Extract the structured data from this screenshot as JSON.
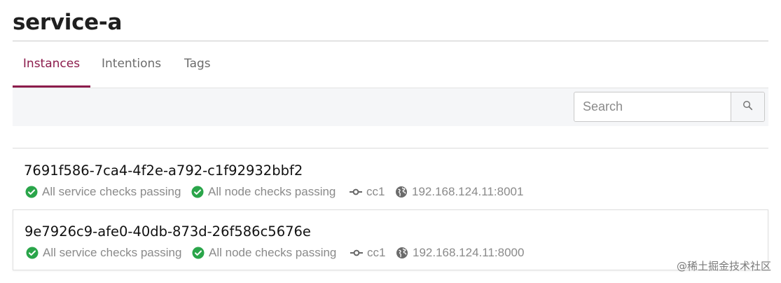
{
  "page": {
    "title": "service-a"
  },
  "tabs": [
    {
      "label": "Instances",
      "active": true
    },
    {
      "label": "Intentions",
      "active": false
    },
    {
      "label": "Tags",
      "active": false
    }
  ],
  "search": {
    "placeholder": "Search",
    "value": ""
  },
  "instances": [
    {
      "id": "7691f586-7ca4-4f2e-a792-c1f92932bbf2",
      "service_check": "All service checks passing",
      "node_check": "All node checks passing",
      "node": "cc1",
      "address": "192.168.124.11:8001"
    },
    {
      "id": "9e7926c9-afe0-40db-873d-26f586c5676e",
      "service_check": "All service checks passing",
      "node_check": "All node checks passing",
      "node": "cc1",
      "address": "192.168.124.11:8000"
    }
  ],
  "watermark": "@稀土掘金技术社区",
  "colors": {
    "accent": "#8c1c4c",
    "passing": "#2aa54a",
    "muted": "#8a8a8a"
  },
  "icons": {
    "check": "check-circle-icon",
    "node": "git-commit-icon",
    "address": "globe-icon",
    "search": "search-icon"
  }
}
